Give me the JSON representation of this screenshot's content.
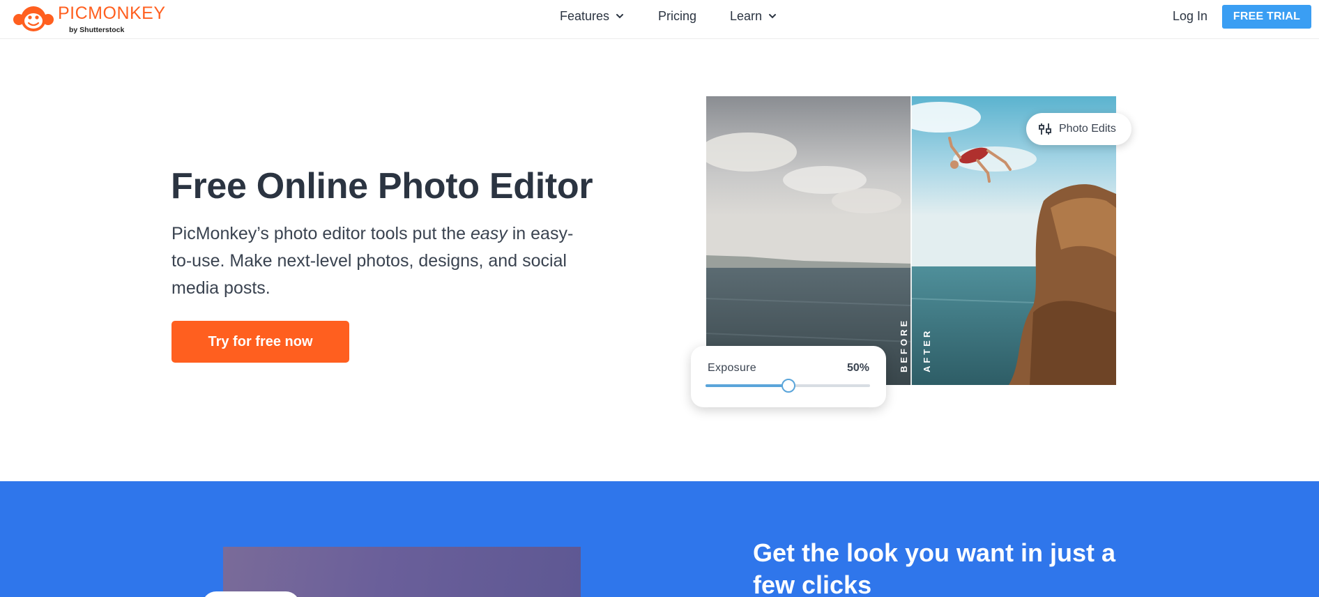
{
  "brand": {
    "name": "PICMONKEY",
    "byline": "by Shutterstock",
    "color": "#ff5f1f"
  },
  "nav": {
    "features": "Features",
    "pricing": "Pricing",
    "learn": "Learn",
    "login": "Log In",
    "trial": "FREE TRIAL",
    "trial_color": "#3a9ef3"
  },
  "hero": {
    "title": "Free Online Photo Editor",
    "desc_before": "PicMonkey’s photo editor tools put the ",
    "desc_em": "easy",
    "desc_after": " in easy-to-use. Make next-level photos, designs, and social media posts.",
    "cta": "Try for free now",
    "cta_color": "#ff5f1f"
  },
  "photo": {
    "before_label": "BEFORE",
    "after_label": "AFTER",
    "chip_label": "Photo Edits",
    "chip_icon": "sliders-icon"
  },
  "exposure": {
    "label": "Exposure",
    "value": "50%",
    "level": 0.5,
    "accent": "#5aa5da"
  },
  "section2": {
    "title": "Get the look you want in just a few clicks",
    "background": "#2f76eb"
  }
}
